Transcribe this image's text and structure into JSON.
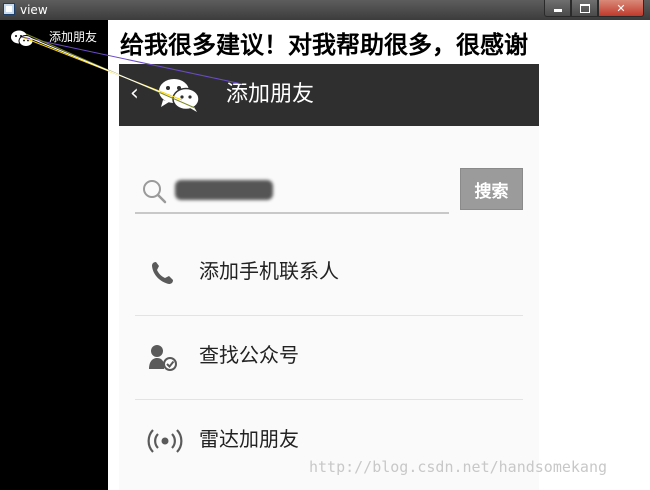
{
  "window": {
    "title": "view",
    "controls": {
      "minimize_icon": "minimize-icon",
      "maximize_icon": "maximize-icon",
      "close_icon": "close-icon"
    }
  },
  "sidebar": {
    "items": [
      {
        "label": "添加朋友",
        "icon": "wechat-icon"
      }
    ]
  },
  "overlay_text": "给我很多建议！对我帮助很多，很感谢",
  "phone": {
    "header": {
      "back_glyph": "‹",
      "title": "添加朋友",
      "logo_icon": "wechat-logo-icon"
    },
    "search": {
      "value": "redacted",
      "button_label": "搜索",
      "icon": "search-icon"
    },
    "menu": [
      {
        "label": "添加手机联系人",
        "icon": "phone-icon"
      },
      {
        "label": "查找公众号",
        "icon": "official-account-icon"
      },
      {
        "label": "雷达加朋友",
        "icon": "radar-icon"
      }
    ]
  },
  "watermark": "http://blog.csdn.net/handsomekang",
  "colors": {
    "title_bar": "#4a4a4a",
    "close_button": "#c0392b",
    "sidebar_bg": "#000000",
    "phone_header": "#2f2f30",
    "search_button": "#9b9b9b"
  }
}
